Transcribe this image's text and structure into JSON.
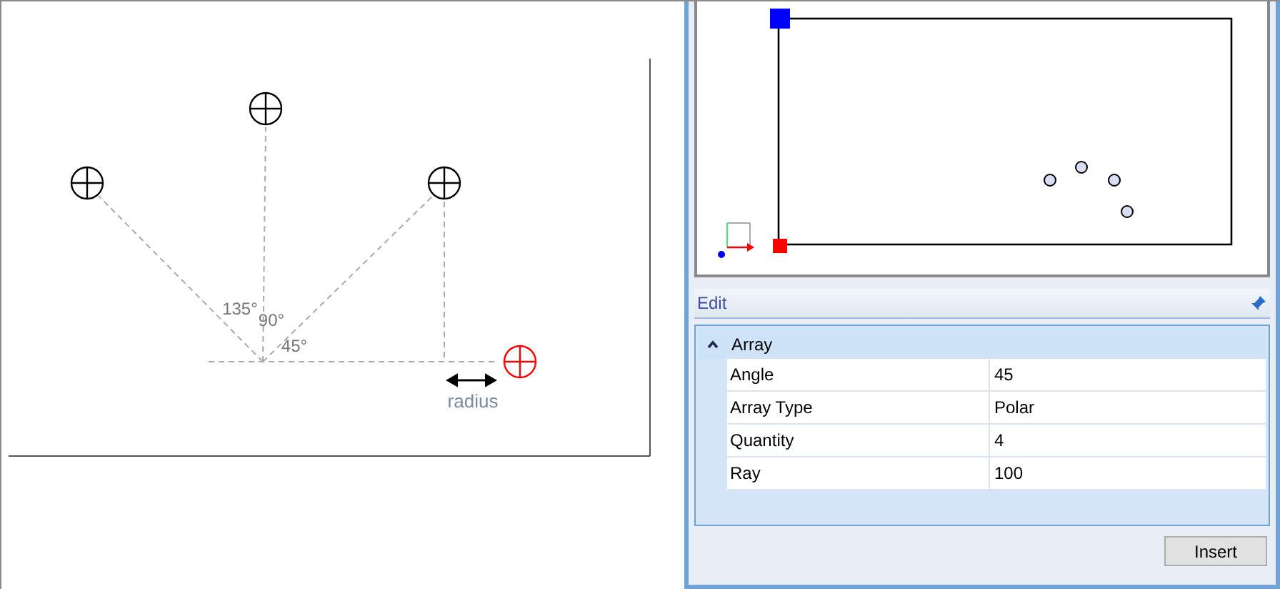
{
  "diagram": {
    "angle_labels": [
      "135°",
      "90°",
      "45°"
    ],
    "radius_label": "radius"
  },
  "edit_panel": {
    "title": "Edit",
    "group": {
      "label": "Array",
      "expanded": true,
      "rows": [
        {
          "name": "Angle",
          "value": "45"
        },
        {
          "name": "Array Type",
          "value": "Polar"
        },
        {
          "name": "Quantity",
          "value": "4"
        },
        {
          "name": "Ray",
          "value": "100"
        }
      ]
    },
    "buttons": [
      "Insert"
    ]
  }
}
